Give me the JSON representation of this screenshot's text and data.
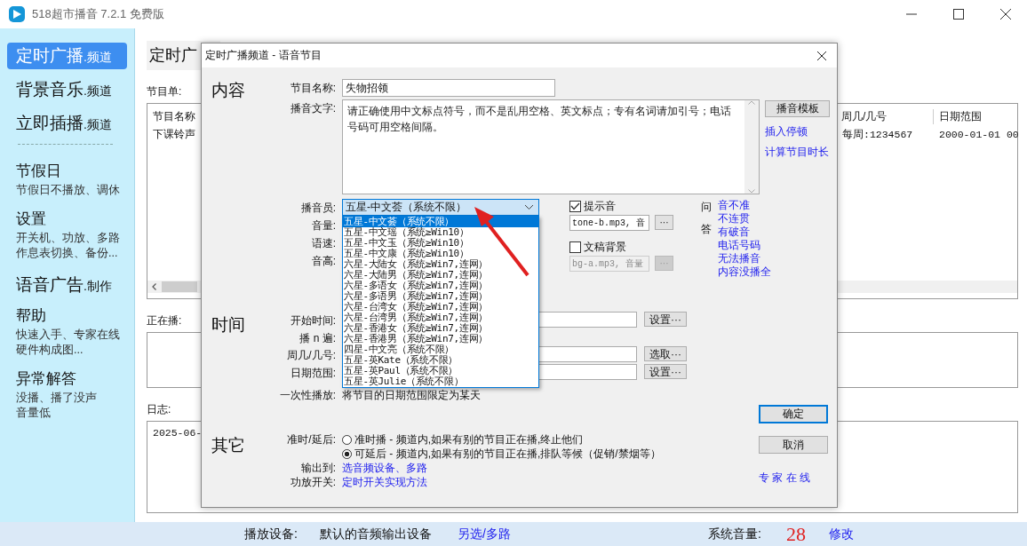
{
  "window": {
    "title": "518超市播音 7.2.1 免费版"
  },
  "sidebar": {
    "items": [
      {
        "kind": "channel",
        "title": "定时广播",
        "suffix": ".频道",
        "selected": true
      },
      {
        "kind": "channel",
        "title": "背景音乐",
        "suffix": ".频道",
        "selected": false
      },
      {
        "kind": "channel",
        "title": "立即插播",
        "suffix": ".频道",
        "selected": false
      },
      {
        "kind": "divider"
      },
      {
        "kind": "section",
        "title": "节假日",
        "lines": [
          "节假日不播放、调休"
        ],
        "selected": false
      },
      {
        "kind": "section",
        "title": "设置",
        "lines": [
          "开关机、功放、多路",
          "作息表切换、备份..."
        ],
        "selected": false
      },
      {
        "kind": "channel",
        "title": "语音广告",
        "suffix": ".制作",
        "selected": false
      },
      {
        "kind": "section",
        "title": "帮助",
        "lines": [
          "快速入手、专家在线",
          "硬件构成图..."
        ],
        "selected": false
      },
      {
        "kind": "section",
        "title": "异常解答",
        "lines": [
          "没播、播了没声",
          "音量低"
        ],
        "selected": false
      }
    ]
  },
  "main": {
    "heading": "定时广",
    "program_list_label": "节目单:",
    "table": {
      "columns": [
        "节目名称",
        "周几/几号",
        "日期范围"
      ],
      "rows": [
        [
          "下课铃声",
          "每周:1234567",
          "2000-01-01 00"
        ]
      ]
    },
    "now_playing_label": "正在播:",
    "log_label": "日志:",
    "log_lines": [
      "2025-06-"
    ]
  },
  "dialog": {
    "title": "定时广播频道 - 语音节目",
    "content": {
      "section": "内容",
      "name_label": "节目名称:",
      "name_value": "失物招领",
      "text_label": "播音文字:",
      "text_value": "请正确使用中文标点符号，而不是乱用空格、英文标点；专有名词请加引号；电话号码可用空格间隔。",
      "template_button": "播音模板",
      "links": [
        "插入停顿",
        "计算节目时长"
      ],
      "announcer_label": "播音员:",
      "announcer_value": "五星-中文荟（系统不限）",
      "announcer_options": [
        {
          "label": "五星-中文荟（系统不限）",
          "selected": true
        },
        {
          "label": "五星-中文瑶（系统≥Win10）",
          "selected": false
        },
        {
          "label": "五星-中文玉（系统≥Win10）",
          "selected": false
        },
        {
          "label": "五星-中文康（系统≥Win10）",
          "selected": false
        },
        {
          "label": "六星-大陆女（系统≥Win7,连网）",
          "selected": false
        },
        {
          "label": "六星-大陆男（系统≥Win7,连网）",
          "selected": false
        },
        {
          "label": "六星-多语女（系统≥Win7,连网）",
          "selected": false
        },
        {
          "label": "六星-多语男（系统≥Win7,连网）",
          "selected": false
        },
        {
          "label": "六星-台湾女（系统≥Win7,连网）",
          "selected": false
        },
        {
          "label": "六星-台湾男（系统≥Win7,连网）",
          "selected": false
        },
        {
          "label": "六星-香港女（系统≥Win7,连网）",
          "selected": false
        },
        {
          "label": "六星-香港男（系统≥Win7,连网）",
          "selected": false
        },
        {
          "label": "四星-中文亮（系统不限）",
          "selected": false
        },
        {
          "label": "五星-英Kate（系统不限）",
          "selected": false
        },
        {
          "label": "五星-英Paul（系统不限）",
          "selected": false
        },
        {
          "label": "五星-英Julie（系统不限）",
          "selected": false
        }
      ],
      "param_labels": [
        "音量:",
        "语速:",
        "音高:"
      ],
      "prompt_sound": {
        "label": "提示音",
        "checked": true,
        "value": "tone-b.mp3, 音",
        "disabled": false,
        "button": "···"
      },
      "background": {
        "label": "文稿背景",
        "checked": false,
        "value": "bg-a.mp3, 音量",
        "disabled": true,
        "button": "···"
      },
      "qa_labels": [
        "问",
        "答"
      ],
      "qa_links": [
        "音不准",
        "不连贯",
        "有破音",
        "电话号码",
        "无法播音",
        "内容没播全"
      ]
    },
    "time": {
      "section": "时间",
      "rows": [
        {
          "kind": "field",
          "label": "开始时间:",
          "button": "设置···"
        },
        {
          "kind": "plain",
          "label": "播 n 遍:"
        },
        {
          "kind": "field",
          "label": "周几/几号:",
          "button": "选取···"
        },
        {
          "kind": "field",
          "label": "日期范围:",
          "button": "设置···"
        },
        {
          "kind": "text",
          "label": "一次性播放:",
          "text": "将节目的日期范围限定为某天"
        }
      ]
    },
    "other": {
      "section": "其它",
      "timing_label": "准时/延后:",
      "timing_options": [
        {
          "label": "准时播 - 频道内,如果有别的节目正在播,终止他们",
          "selected": false
        },
        {
          "label": "可延后 - 频道内,如果有别的节目正在播,排队等候（促销/禁烟等）",
          "selected": true
        }
      ],
      "output_label": "输出到:",
      "output_link": "选音频设备、多路",
      "amp_label": "功放开关:",
      "amp_link": "定时开关实现方法"
    },
    "ok_button": "确定",
    "cancel_button": "取消",
    "expert_link": "专 家 在 线"
  },
  "status_bar": {
    "device_label": "播放设备:",
    "device": "默认的音频输出设备",
    "device_link": "另选/多路",
    "volume_label": "系统音量:",
    "volume": "28",
    "volume_link": "修改"
  }
}
